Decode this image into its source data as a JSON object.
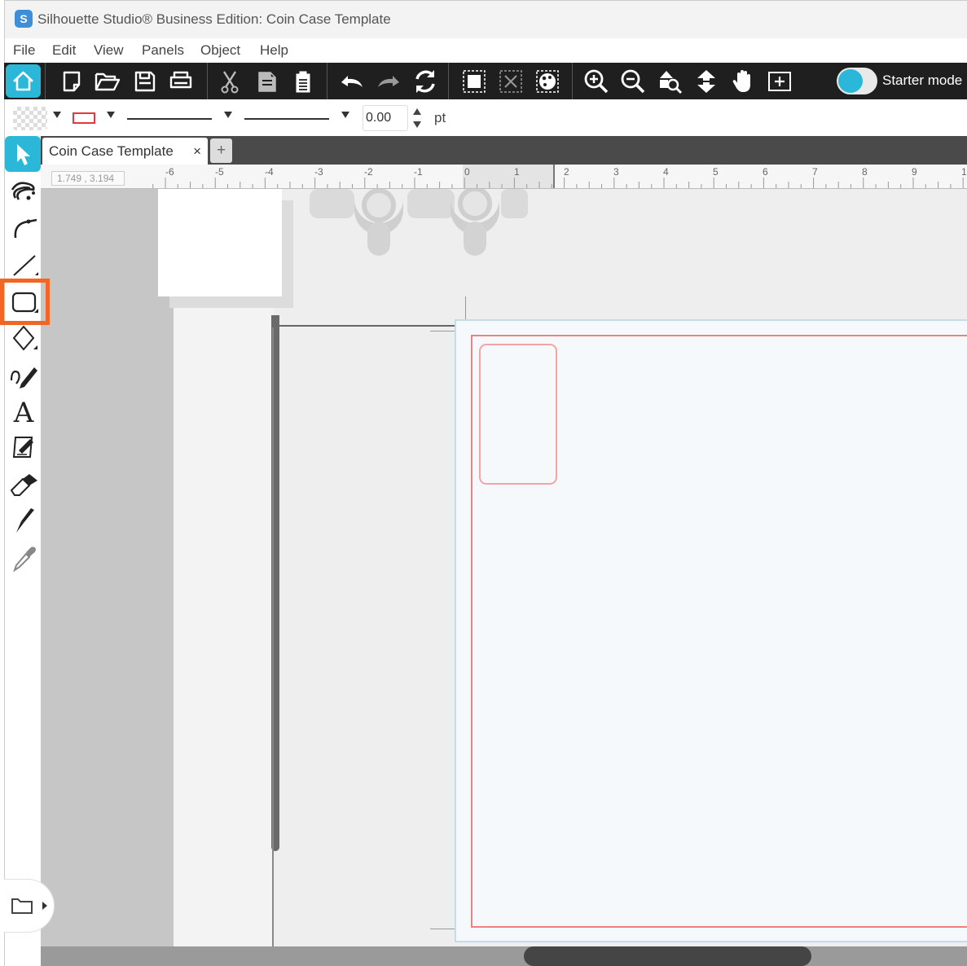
{
  "window": {
    "app_icon_letter": "S",
    "title": "Silhouette Studio® Business Edition: Coin Case Template"
  },
  "menu": {
    "items": [
      "File",
      "Edit",
      "View",
      "Panels",
      "Object",
      "Help"
    ]
  },
  "toolbar": {
    "mode_label": "Starter mode",
    "icons": [
      "home-icon",
      "new-document-icon",
      "open-folder-icon",
      "save-icon",
      "print-icon",
      "cut-icon",
      "copy-icon",
      "paste-icon",
      "undo-icon",
      "redo-icon",
      "rotate-icon",
      "group-icon",
      "ungroup-icon",
      "compound-path-icon",
      "zoom-in-icon",
      "zoom-out-icon",
      "zoom-selection-icon",
      "fit-to-page-icon",
      "pan-hand-icon",
      "add-page-icon"
    ]
  },
  "properties": {
    "line_width": "0.00",
    "unit": "pt",
    "line_color": "#e23a3a"
  },
  "tabs": {
    "doc_title": "Coin Case Template",
    "close_symbol": "×",
    "add_symbol": "+"
  },
  "ruler": {
    "coordinates": "1.749 , 3.194",
    "labels": [
      "-6",
      "-5",
      "-4",
      "-3",
      "-2",
      "-1",
      "0",
      "1",
      "2",
      "3",
      "4",
      "5",
      "6",
      "7",
      "8",
      "9",
      "1"
    ]
  },
  "colors": {
    "accent": "#2ab7d8",
    "highlight": "#f26522",
    "cut_line": "#f08080",
    "page_border": "#c2dde8"
  }
}
